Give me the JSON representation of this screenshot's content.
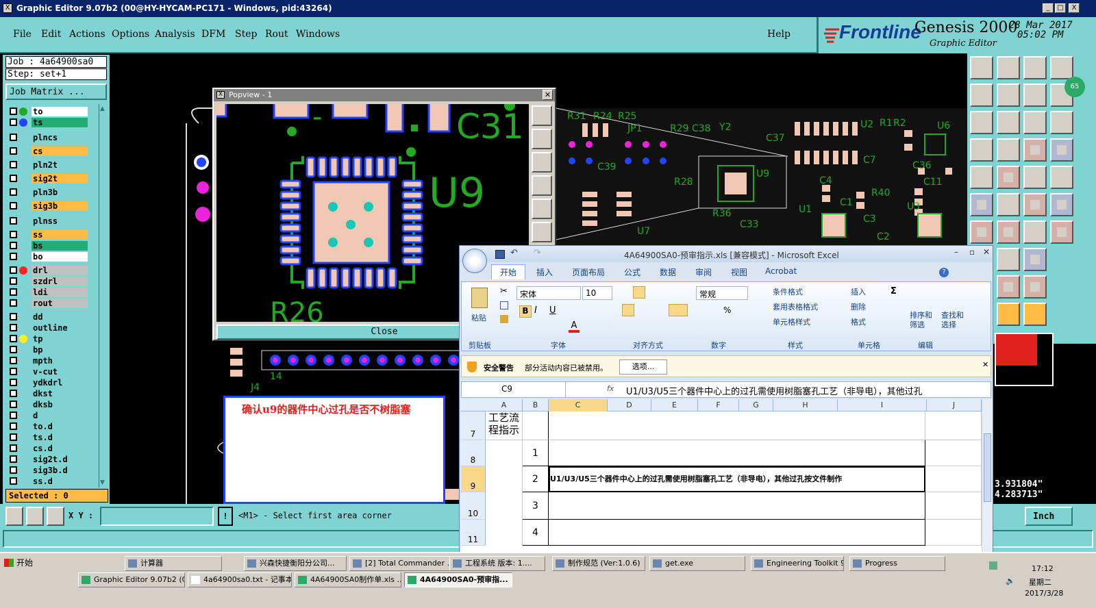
{
  "window": {
    "title": "Graphic Editor 9.07b2 (00@HY-HYCAM-PC171 - Windows, pid:43264)",
    "minimize": "_",
    "maximize": "□",
    "close": "X"
  },
  "menu": [
    "File",
    "Edit",
    "Actions",
    "Options",
    "Analysis",
    "DFM",
    "Step",
    "Rout",
    "Windows"
  ],
  "help": "Help",
  "brand": {
    "logo": "Frontline",
    "product": "Genesis 2000",
    "subtitle": "Graphic Editor",
    "date": "28 Mar 2017",
    "time": "05:02 PM"
  },
  "job": {
    "job": "Job : 4a64900sa0",
    "step": "Step: set+1",
    "matrix_button": "Job Matrix ..."
  },
  "layers": [
    {
      "name": "to",
      "color": "#ffffff",
      "dot": "#22aa22"
    },
    {
      "name": "ts",
      "color": "#22aa77",
      "dot": "#2244ff"
    },
    {
      "name": "plncs",
      "color": "#7fd3d3",
      "dot": ""
    },
    {
      "name": "cs",
      "color": "#ffbb44",
      "dot": ""
    },
    {
      "name": "pln2t",
      "color": "#7fd3d3",
      "dot": ""
    },
    {
      "name": "sig2t",
      "color": "#ffbb44",
      "dot": ""
    },
    {
      "name": "pln3b",
      "color": "#7fd3d3",
      "dot": ""
    },
    {
      "name": "sig3b",
      "color": "#ffbb44",
      "dot": ""
    },
    {
      "name": "plnss",
      "color": "#7fd3d3",
      "dot": ""
    },
    {
      "name": "ss",
      "color": "#ffbb44",
      "dot": ""
    },
    {
      "name": "bs",
      "color": "#22aa77",
      "dot": ""
    },
    {
      "name": "bo",
      "color": "#ffffff",
      "dot": ""
    },
    {
      "name": "drl",
      "color": "#c0c0c0",
      "dot": "#ff2222"
    },
    {
      "name": "szdrl",
      "color": "#c0c0c0",
      "dot": ""
    },
    {
      "name": "ldi",
      "color": "#c0c0c0",
      "dot": ""
    },
    {
      "name": "rout",
      "color": "#c0c0c0",
      "dot": ""
    },
    {
      "name": "dd",
      "color": "#7fd3d3",
      "dot": ""
    },
    {
      "name": "outline",
      "color": "#7fd3d3",
      "dot": ""
    },
    {
      "name": "tp",
      "color": "#7fd3d3",
      "dot": "#ffee22"
    },
    {
      "name": "bp",
      "color": "#7fd3d3",
      "dot": ""
    },
    {
      "name": "mpth",
      "color": "#7fd3d3",
      "dot": ""
    },
    {
      "name": "v-cut",
      "color": "#7fd3d3",
      "dot": ""
    },
    {
      "name": "ydkdrl",
      "color": "#7fd3d3",
      "dot": ""
    },
    {
      "name": "dkst",
      "color": "#7fd3d3",
      "dot": ""
    },
    {
      "name": "dksb",
      "color": "#7fd3d3",
      "dot": ""
    },
    {
      "name": "d",
      "color": "#7fd3d3",
      "dot": ""
    },
    {
      "name": "to.d",
      "color": "#7fd3d3",
      "dot": ""
    },
    {
      "name": "ts.d",
      "color": "#7fd3d3",
      "dot": ""
    },
    {
      "name": "cs.d",
      "color": "#7fd3d3",
      "dot": ""
    },
    {
      "name": "sig2t.d",
      "color": "#7fd3d3",
      "dot": ""
    },
    {
      "name": "sig3b.d",
      "color": "#7fd3d3",
      "dot": ""
    },
    {
      "name": "ss.d",
      "color": "#7fd3d3",
      "dot": ""
    }
  ],
  "selected": "Selected : 0",
  "popview": {
    "title": "Popview - 1",
    "close": "Close",
    "labels": {
      "c31": "C31",
      "u9": "U9",
      "r26": "R26"
    }
  },
  "note": "确认u9的器件中心过孔是否不树脂塞",
  "pcb_labels": [
    "R31",
    "R24",
    "R25",
    "JP1",
    "R29",
    "C38",
    "Y2",
    "C37",
    "U2",
    "R1",
    "R2",
    "U6",
    "C39",
    "R28",
    "U9",
    "C7",
    "C36",
    "C4",
    "R40",
    "C11",
    "U1",
    "C1",
    "U3",
    "R36",
    "C33",
    "C3",
    "U7",
    "C2",
    "J4",
    "14"
  ],
  "status": {
    "xy_label": "X Y :",
    "prompt": "<M1> - Select first area corner",
    "coord_x": "3.931804\"",
    "coord_y": "4.283713\"",
    "units": "Inch",
    "bang": "!"
  },
  "excel": {
    "title": "4A64900SA0-预审指示.xls  [兼容模式] - Microsoft Excel",
    "tabs": [
      "开始",
      "插入",
      "页面布局",
      "公式",
      "数据",
      "审阅",
      "视图",
      "Acrobat"
    ],
    "font": "宋体",
    "size": "10",
    "number_format": "常规",
    "clipboard": {
      "paste": "粘贴",
      "group": "剪贴板"
    },
    "groups": [
      "字体",
      "对齐方式",
      "数字",
      "样式",
      "单元格",
      "编辑"
    ],
    "styles": [
      "条件格式",
      "套用表格格式",
      "单元格样式"
    ],
    "cells_cmds": [
      "插入",
      "删除",
      "格式"
    ],
    "edit_cmds": [
      "排序和筛选",
      "查找和选择"
    ],
    "security_label": "安全警告",
    "security_text": "部分活动内容已被禁用。",
    "options_btn": "选项...",
    "name_box": "C9",
    "fx": "fx",
    "formula": "U1/U3/U5三个器件中心上的过孔需使用树脂塞孔工艺（非导电），其他过孔",
    "columns": [
      "A",
      "B",
      "C",
      "D",
      "E",
      "F",
      "G",
      "H",
      "I",
      "J"
    ],
    "rows": [
      {
        "num": "7",
        "a": "工艺流程指示",
        "b": "",
        "c": ""
      },
      {
        "num": "8",
        "a": "",
        "b": "1",
        "c": ""
      },
      {
        "num": "9",
        "a": "",
        "b": "2",
        "c": "U1/U3/U5三个器件中心上的过孔需使用树脂塞孔工艺（非导电），其他过孔按文件制作"
      },
      {
        "num": "10",
        "a": "",
        "b": "3",
        "c": ""
      },
      {
        "num": "11",
        "a": "",
        "b": "4",
        "c": ""
      }
    ]
  },
  "taskbar": {
    "start": "开始",
    "row1": [
      "计算器",
      "兴森快捷衡阳分公司...",
      "[2] Total Commander ...",
      "工程系统  版本: 1....",
      "制作规范 (Ver:1.0.6)",
      "get.exe",
      "Engineering Toolkit 9....",
      "Progress"
    ],
    "row2": [
      "Graphic Editor 9.07b2 (0...",
      "4a64900sa0.txt - 记事本",
      "4A64900SA0制作单.xls ...",
      "4A64900SA0-预审指..."
    ],
    "clock": {
      "time": "17:12",
      "day": "星期二",
      "date": "2017/3/28"
    }
  }
}
